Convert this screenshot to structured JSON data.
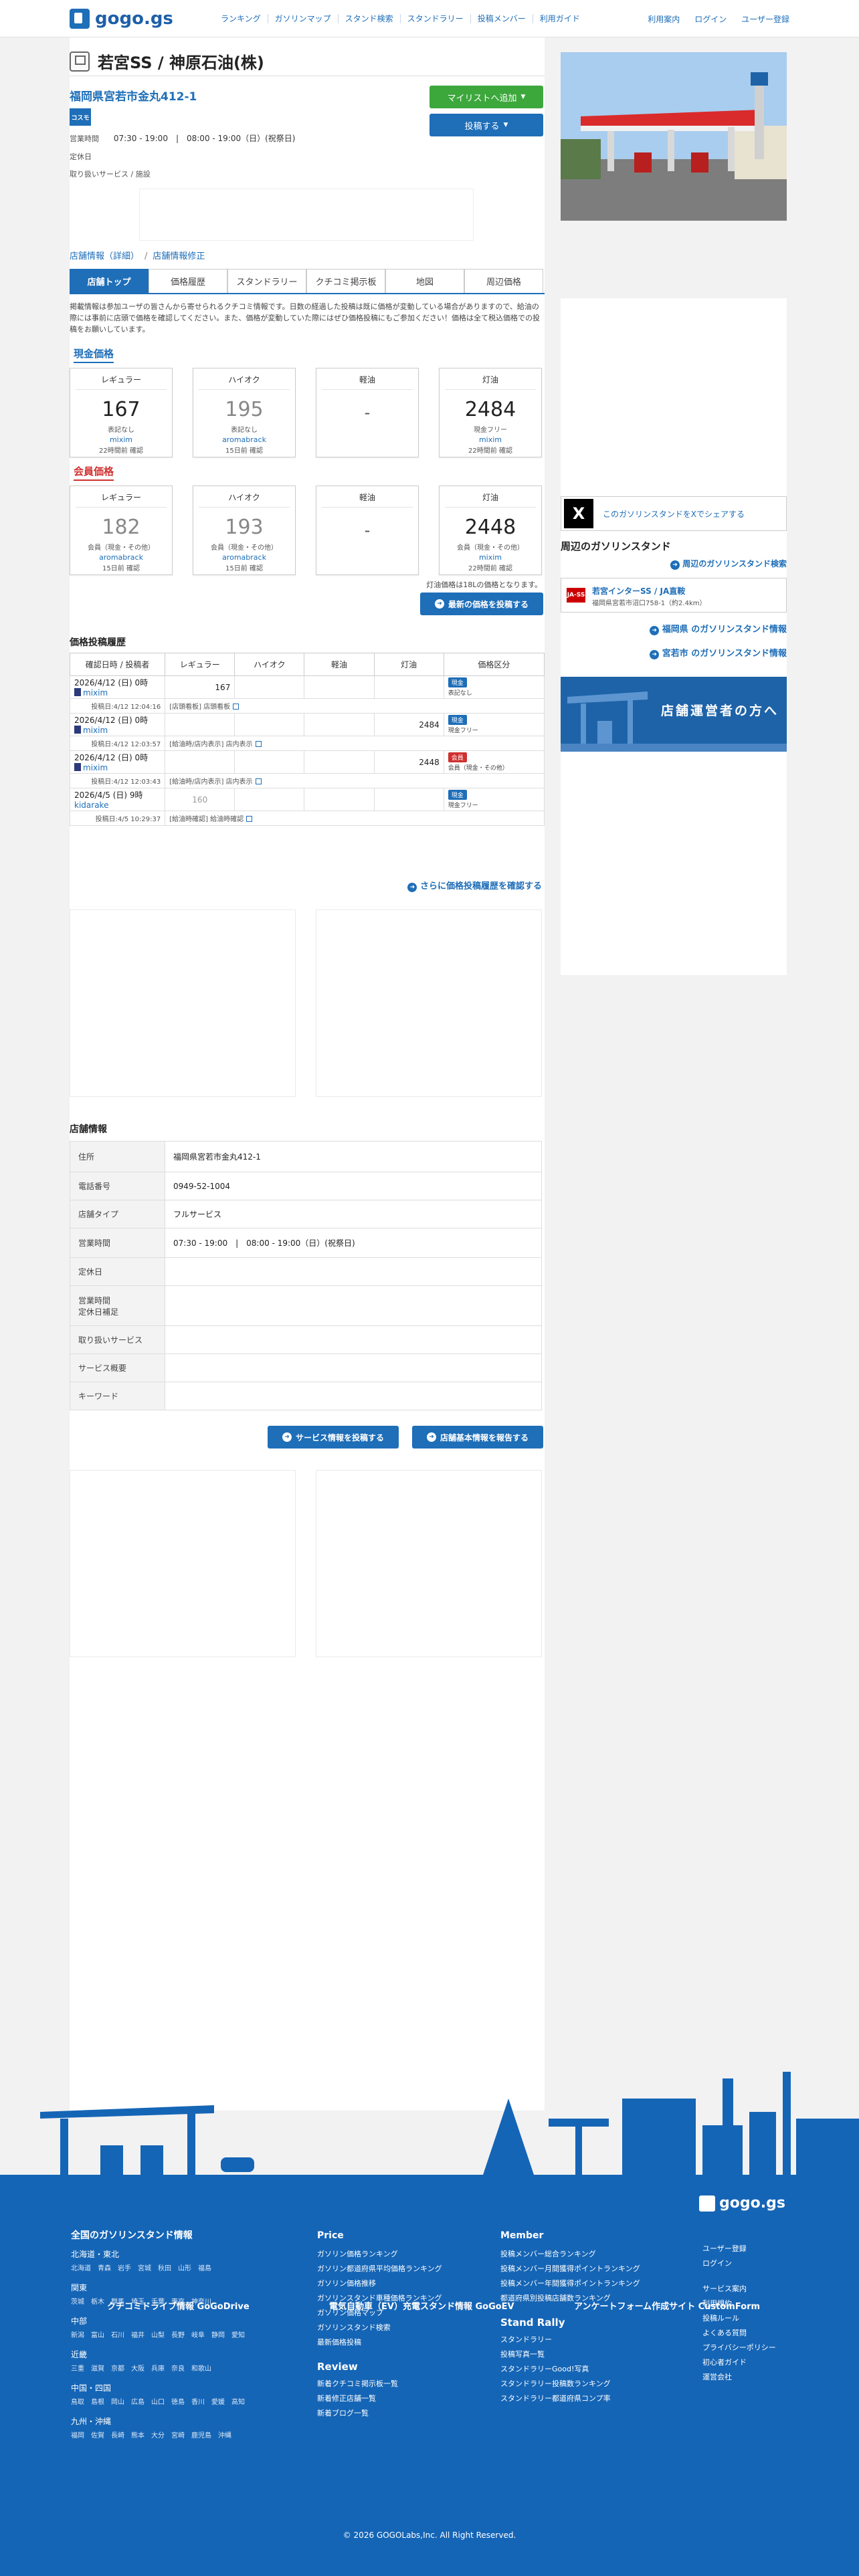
{
  "site": {
    "logo_text": "gogo.gs"
  },
  "nav": [
    "ランキング",
    "ガソリンマップ",
    "スタンド検索",
    "スタンドラリー",
    "投稿メンバー",
    "利用ガイド"
  ],
  "account": [
    "利用案内",
    "ログイン",
    "ユーザー登録"
  ],
  "station": {
    "title": "若宮SS / 神原石油(株)",
    "address": "福岡県宮若市金丸412-1",
    "brand_label": "コスモ",
    "hours_label": "営業時間",
    "hours": "07:30 - 19:00　|　08:00 - 19:00（日）(祝祭日)",
    "closed_label": "定休日",
    "services_label": "取り扱いサービス / 施設"
  },
  "buttons": {
    "mylist": "マイリストへ追加",
    "post": "投稿する",
    "latest": "最新の価格を投稿する",
    "more_history": "さらに価格投稿履歴を確認する",
    "service": "サービス情報を投稿する",
    "report": "店舗基本情報を報告する"
  },
  "sublinks": {
    "detail": "店舗情報（詳細）",
    "edit": "店舗情報修正"
  },
  "tabs": [
    "店舗トップ",
    "価格履歴",
    "スタンドラリー",
    "クチコミ掲示板",
    "地図",
    "周辺価格"
  ],
  "notice": "掲載情報は参加ユーザの皆さんから寄せられるクチコミ情報です。日数の経過した投稿は既に価格が変動している場合がありますので、給油の際には事前に店頭で価格を確認してください。また、価格が変動していた際にはぜひ価格投稿にもご参加ください！価格は全て税込価格での投稿をお願いしています。",
  "cash": {
    "heading": "現金価格",
    "cards": [
      {
        "kind": "レギュラー",
        "value": "167",
        "pay": "表記なし",
        "user": "mixim",
        "conf": "22時間前 確認"
      },
      {
        "kind": "ハイオク",
        "value": "195",
        "pay": "表記なし",
        "user": "aromabrack",
        "conf": "15日前 確認"
      },
      {
        "kind": "軽油",
        "value": "-",
        "pay": "",
        "user": "",
        "conf": ""
      },
      {
        "kind": "灯油",
        "value": "2484",
        "pay": "現金フリー",
        "user": "mixim",
        "conf": "22時間前 確認"
      }
    ]
  },
  "member": {
    "heading": "会員価格",
    "cards": [
      {
        "kind": "レギュラー",
        "value": "182",
        "pay": "会員（現金・その他）",
        "user": "aromabrack",
        "conf": "15日前 確認"
      },
      {
        "kind": "ハイオク",
        "value": "193",
        "pay": "会員（現金・その他）",
        "user": "aromabrack",
        "conf": "15日前 確認"
      },
      {
        "kind": "軽油",
        "value": "-",
        "pay": "",
        "user": "",
        "conf": ""
      },
      {
        "kind": "灯油",
        "value": "2448",
        "pay": "会員（現金・その他）",
        "user": "mixim",
        "conf": "22時間前 確認"
      }
    ]
  },
  "kerosene_note": "灯油価格は18Lの価格となります。",
  "history": {
    "heading": "価格投稿履歴",
    "columns": [
      "確認日時 / 投稿者",
      "レギュラー",
      "ハイオク",
      "軽油",
      "灯油",
      "価格区分"
    ],
    "rows": [
      {
        "date": "2026/4/12 (日) 0時",
        "user": "mixim",
        "reg": "167",
        "high": "",
        "diesel": "",
        "kero": "",
        "badge": "現金",
        "badge_type": "cash",
        "ptype": "表記なし",
        "posted": "投稿日:4/12 12:04:16",
        "note": "[店頭看板] 店頭看板"
      },
      {
        "date": "2026/4/12 (日) 0時",
        "user": "mixim",
        "reg": "",
        "high": "",
        "diesel": "",
        "kero": "2484",
        "badge": "現金",
        "badge_type": "cash",
        "ptype": "現金フリー",
        "posted": "投稿日:4/12 12:03:57",
        "note": "[給油時/店内表示] 店内表示"
      },
      {
        "date": "2026/4/12 (日) 0時",
        "user": "mixim",
        "reg": "",
        "high": "",
        "diesel": "",
        "kero": "2448",
        "badge": "会員",
        "badge_type": "member",
        "ptype": "会員（現金・その他）",
        "posted": "投稿日:4/12 12:03:43",
        "note": "[給油時/店内表示] 店内表示"
      },
      {
        "date": "2026/4/5 (日) 9時",
        "user": "kidarake",
        "reg": "160",
        "high": "",
        "diesel": "",
        "kero": "",
        "badge": "現金",
        "badge_type": "cash",
        "ptype": "現金フリー",
        "posted": "投稿日:4/5 10:29:37",
        "note": "[給油時確認] 給油時確認"
      }
    ]
  },
  "info": {
    "heading": "店舗情報",
    "rows": [
      {
        "label": "住所",
        "value": "福岡県宮若市金丸412-1"
      },
      {
        "label": "電話番号",
        "value": "0949-52-1004"
      },
      {
        "label": "店舗タイプ",
        "value": "フルサービス"
      },
      {
        "label": "営業時間",
        "value": "07:30 - 19:00　|　08:00 - 19:00（日）(祝祭日)"
      },
      {
        "label": "定休日",
        "value": ""
      },
      {
        "label": "営業時間\n定休日補足",
        "value": ""
      },
      {
        "label": "取り扱いサービス",
        "value": ""
      },
      {
        "label": "サービス概要",
        "value": ""
      },
      {
        "label": "キーワード",
        "value": ""
      }
    ]
  },
  "side": {
    "share": "このガソリンスタンドをXでシェアする",
    "near_heading": "周辺のガソリンスタンド",
    "near_link": "周辺のガソリンスタンド検索",
    "near_name": "若宮インターSS / JA直鞍",
    "near_addr": "福岡県宮若市沼口758-1（約2.4km）",
    "near_brand": "JA-SS",
    "pref_link": "福岡県 のガソリンスタンド情報",
    "city_link": "宮若市 のガソリンスタンド情報",
    "owner_banner": "店舗運営者の方へ"
  },
  "footer": {
    "logo": "gogo.gs",
    "national_heading": "全国のガソリンスタンド情報",
    "regions": [
      {
        "name": "北海道・東北",
        "prefs": "北海道　青森　岩手　宮城　秋田　山形　福島"
      },
      {
        "name": "関東",
        "prefs": "茨城　栃木　群馬　埼玉　千葉　東京　神奈川"
      },
      {
        "name": "中部",
        "prefs": "新潟　富山　石川　福井　山梨　長野　岐阜　静岡　愛知"
      },
      {
        "name": "近畿",
        "prefs": "三重　滋賀　京都　大阪　兵庫　奈良　和歌山"
      },
      {
        "name": "中国・四国",
        "prefs": "鳥取　島根　岡山　広島　山口　徳島　香川　愛媛　高知"
      },
      {
        "name": "九州・沖縄",
        "prefs": "福岡　佐賀　長崎　熊本　大分　宮崎　鹿児島　沖縄"
      }
    ],
    "price_heading": "Price",
    "price_items": [
      "ガソリン価格ランキング",
      "ガソリン都道府県平均価格ランキング",
      "ガソリン価格推移",
      "ガソリンスタンド車種価格ランキング",
      "ガソリン価格マップ",
      "ガソリンスタンド検索",
      "最新価格投稿"
    ],
    "review_heading": "Review",
    "review_items": [
      "新着クチコミ掲示板一覧",
      "新着修正店舗一覧",
      "新着ブログ一覧"
    ],
    "member_heading": "Member",
    "member_items": [
      "投稿メンバー総合ランキング",
      "投稿メンバー月間獲得ポイントランキング",
      "投稿メンバー年間獲得ポイントランキング",
      "都道府県別投稿店舗数ランキング"
    ],
    "rally_heading": "Stand Rally",
    "rally_items": [
      "スタンドラリー",
      "投稿写真一覧",
      "スタンドラリーGood!写真",
      "スタンドラリー投稿数ランキング",
      "スタンドラリー都道府県コンプ率"
    ],
    "misc_items1": [
      "ユーザー登録",
      "ログイン"
    ],
    "misc_items2": [
      "サービス案内",
      "利用規約",
      "投稿ルール",
      "よくある質問",
      "プライバシーポリシー",
      "初心者ガイド",
      "運営会社"
    ],
    "links": [
      "クチコミドライブ情報 GoGoDrive",
      "電気自動車（EV）充電スタンド情報 GoGoEV",
      "アンケートフォーム作成サイト CustomForm"
    ],
    "copyright": "© 2026 GOGOLabs,Inc. All Right Reserved."
  }
}
